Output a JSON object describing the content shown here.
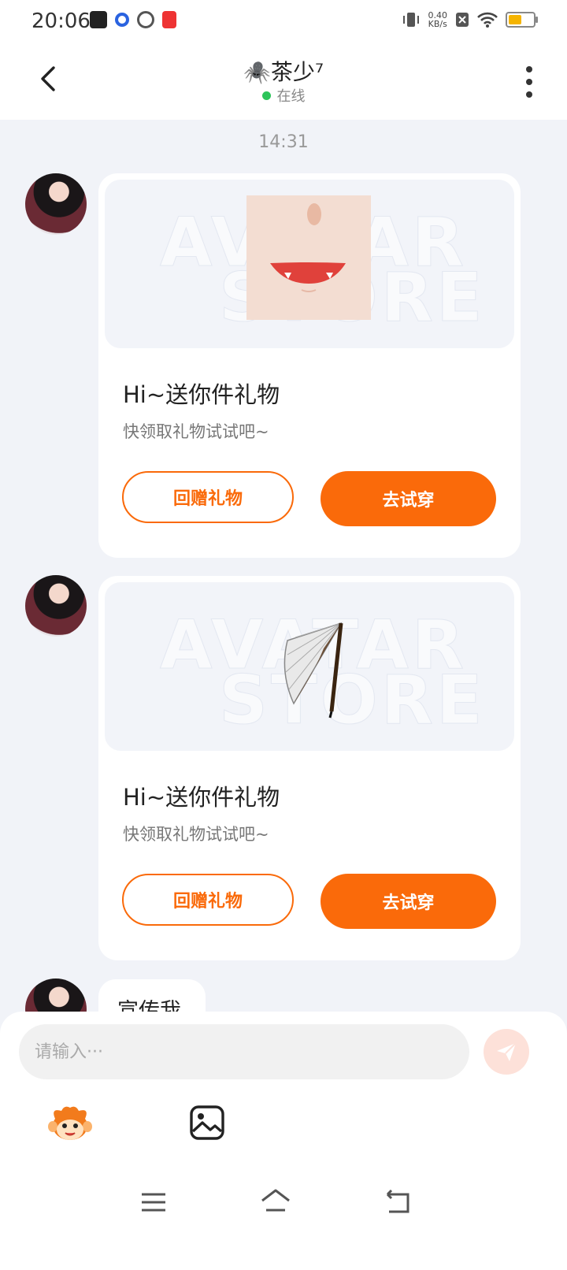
{
  "status_bar": {
    "time": "20:06",
    "net_speed_value": "0.40",
    "net_speed_unit": "KB/s",
    "battery_color": "#f5b400"
  },
  "header": {
    "title": "🕷️茶少⁷",
    "status": "在线",
    "status_color": "#2dc45a"
  },
  "chat": {
    "timestamp": "14:31",
    "watermark_line1": "AVATAR",
    "watermark_line2": "STORE",
    "gift_cards": [
      {
        "item": "face-mouth-icon",
        "title": "Hi~送你件礼物",
        "subtitle": "快领取礼物试试吧~",
        "return_gift_label": "回赠礼物",
        "try_on_label": "去试穿"
      },
      {
        "item": "folding-fan-icon",
        "title": "Hi~送你件礼物",
        "subtitle": "快领取礼物试试吧~",
        "return_gift_label": "回赠礼物",
        "try_on_label": "去试穿"
      }
    ],
    "last_message": "宣传我"
  },
  "composer": {
    "placeholder": "请输入···",
    "accent_color": "#fa6a0a"
  }
}
